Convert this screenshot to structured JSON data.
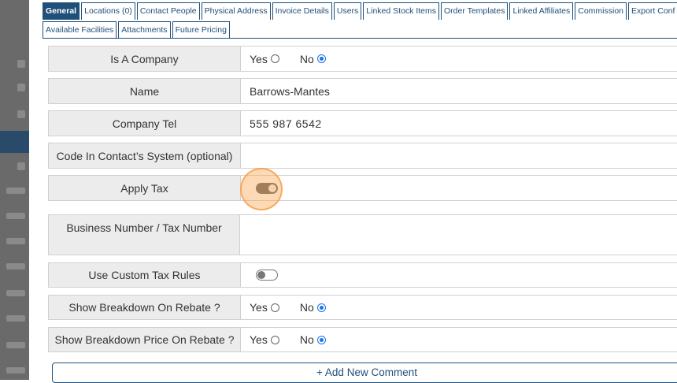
{
  "tabs": {
    "row1": [
      "General",
      "Locations (0)",
      "Contact People",
      "Physical Address",
      "Invoice Details",
      "Users",
      "Linked Stock Items",
      "Order Templates",
      "Linked Affiliates",
      "Commission",
      "Export Conf"
    ],
    "row2": [
      "Available Facilities",
      "Attachments",
      "Future Pricing"
    ],
    "active": "General"
  },
  "form": {
    "is_company": {
      "label": "Is A Company",
      "yes": "Yes",
      "no": "No",
      "selected": "No"
    },
    "name": {
      "label": "Name",
      "value": "Barrows-Mantes"
    },
    "company_tel": {
      "label": "Company Tel",
      "value": "555 987 6542"
    },
    "code": {
      "label": "Code In Contact’s System (optional)",
      "value": ""
    },
    "apply_tax": {
      "label": "Apply Tax",
      "on": true
    },
    "business_number": {
      "label": "Business Number / Tax Number",
      "value": ""
    },
    "custom_tax": {
      "label": "Use Custom Tax Rules",
      "on": false
    },
    "breakdown_rebate": {
      "label": "Show Breakdown On Rebate ?",
      "yes": "Yes",
      "no": "No",
      "selected": "No"
    },
    "breakdown_price_rebate": {
      "label": "Show Breakdown Price On Rebate ?",
      "yes": "Yes",
      "no": "No",
      "selected": "No"
    }
  },
  "add_comment": {
    "label": "+ Add New Comment"
  },
  "colors": {
    "accent": "#1f4f7a",
    "radio": "#1a73e8",
    "highlight": "#f5963c"
  }
}
